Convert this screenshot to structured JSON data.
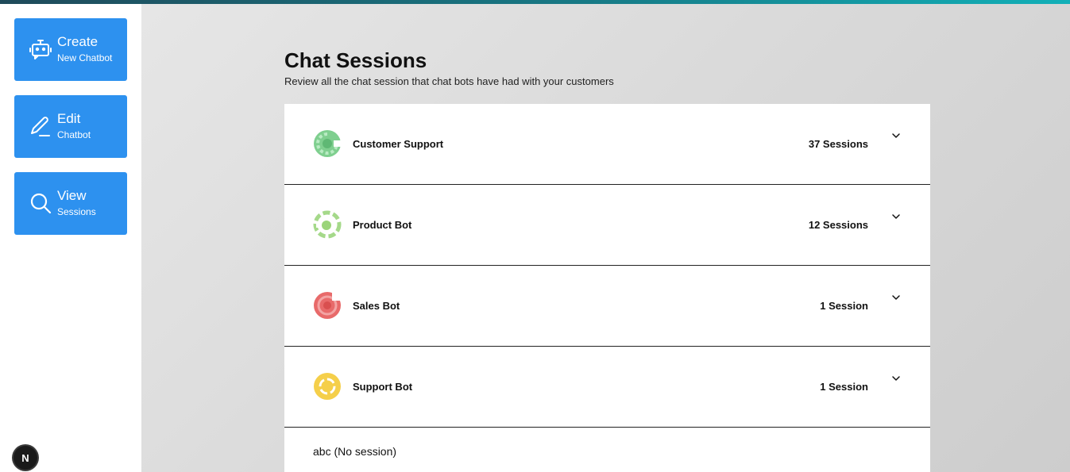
{
  "sidebar": {
    "items": [
      {
        "title": "Create",
        "subtitle": "New Chatbot",
        "icon": "robot-icon"
      },
      {
        "title": "Edit",
        "subtitle": "Chatbot",
        "icon": "pencil-icon"
      },
      {
        "title": "View",
        "subtitle": "Sessions",
        "icon": "search-icon"
      }
    ],
    "badge": "N"
  },
  "page": {
    "title": "Chat Sessions",
    "subtitle": "Review all the chat session that chat bots have had with your customers"
  },
  "chatbots": [
    {
      "name": "Customer Support",
      "sessions": "37 Sessions",
      "color": "#7fcf8f"
    },
    {
      "name": "Product Bot",
      "sessions": "12 Sessions",
      "color": "#a5d98a"
    },
    {
      "name": "Sales Bot",
      "sessions": "1 Session",
      "color": "#e86a6a"
    },
    {
      "name": "Support Bot",
      "sessions": "1 Session",
      "color": "#f5cf4a"
    }
  ],
  "empty": {
    "label": "abc (No session)"
  },
  "colors": {
    "accent": "#2d91ef",
    "topbar_start": "#1f4a5a",
    "topbar_end": "#12b0b8"
  }
}
